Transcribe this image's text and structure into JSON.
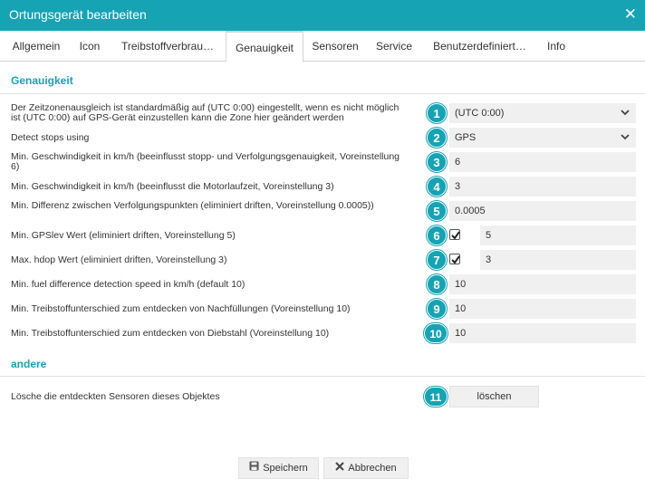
{
  "window": {
    "title": "Ortungsgerät bearbeiten",
    "close_glyph": "✕"
  },
  "tabs": [
    {
      "label": "Allgemein"
    },
    {
      "label": "Icon"
    },
    {
      "label": "Treibstoffverbrau…"
    },
    {
      "label": "Genauigkeit"
    },
    {
      "label": "Sensoren"
    },
    {
      "label": "Service"
    },
    {
      "label": "Benutzerdefiniert…"
    },
    {
      "label": "Info"
    }
  ],
  "active_tab": "Genauigkeit",
  "sections": {
    "accuracy": "Genauigkeit",
    "other": "andere"
  },
  "rows": [
    {
      "badge": "1",
      "label": "Der Zeitzonenausgleich ist standardmäßig auf (UTC 0:00) eingestellt, wenn es nicht möglich ist (UTC 0:00) auf GPS-Gerät einzustellen kann die Zone hier geändert werden",
      "value": "(UTC 0:00)"
    },
    {
      "badge": "2",
      "label": "Detect stops using",
      "value": "GPS"
    },
    {
      "badge": "3",
      "label": "Min. Geschwindigkeit in km/h (beeinflusst stopp- und Verfolgungsgenauigkeit, Voreinstellung 6)",
      "value": "6"
    },
    {
      "badge": "4",
      "label": "Min. Geschwindigkeit in km/h (beeinflusst die Motorlaufzeit, Voreinstellung 3)",
      "value": "3"
    },
    {
      "badge": "5",
      "label": "Min. Differenz zwischen Verfolgungspunkten (eliminiert driften, Voreinstellung 0.0005))",
      "value": "0.0005"
    },
    {
      "badge": "6",
      "label": "Min. GPSlev Wert (eliminiert driften, Voreinstellung 5)",
      "value": "5",
      "checked": true
    },
    {
      "badge": "7",
      "label": "Max. hdop Wert (eliminiert driften, Voreinstellung 3)",
      "value": "3",
      "checked": true
    },
    {
      "badge": "8",
      "label": "Min. fuel difference detection speed in km/h (default 10)",
      "value": "10"
    },
    {
      "badge": "9",
      "label": "Min. Treibstoffunterschied zum entdecken von Nachfüllungen (Voreinstellung 10)",
      "value": "10"
    },
    {
      "badge": "10",
      "label": "Min. Treibstoffunterschied zum entdecken von Diebstahl (Voreinstellung 10)",
      "value": "10"
    }
  ],
  "other_row": {
    "badge": "11",
    "label": "Lösche die entdeckten Sensoren dieses Objektes",
    "button": "löschen"
  },
  "footer": {
    "save": "Speichern",
    "cancel": "Abbrechen"
  },
  "colors": {
    "accent": "#16a3b4",
    "field_bg": "#f0f0f0"
  },
  "icons": {
    "save": "floppy-disk-icon",
    "cancel": "x-icon",
    "dropdown": "chevron-down-icon"
  }
}
